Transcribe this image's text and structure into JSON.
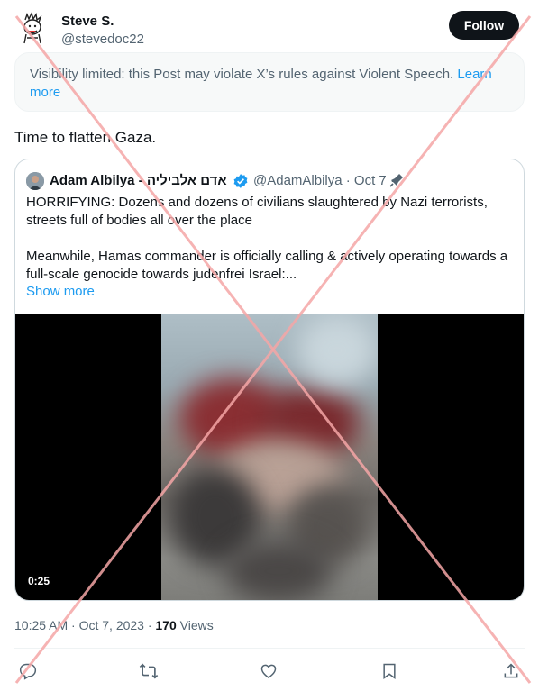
{
  "author": {
    "name": "Steve S.",
    "handle": "@stevedoc22",
    "follow_label": "Follow"
  },
  "notice": {
    "text": "Visibility limited: this Post may violate X’s rules against Violent Speech. ",
    "link": "Learn more"
  },
  "tweet": {
    "text": "Time to flatten Gaza."
  },
  "quoted": {
    "name": "Adam Albilya - אדם אלביליה",
    "handle": "@AdamAlbilya · Oct 7 ·",
    "paragraph1": "HORRIFYING: Dozens and dozens of civilians slaughtered by Nazi terrorists, streets full of bodies all over the place",
    "paragraph2": "Meanwhile, Hamas commander is officially calling & actively operating towards a full-scale genocide towards judenfrei Israel:...",
    "show_more": "Show more",
    "video_duration": "0:25"
  },
  "meta": {
    "time": "10:25 AM · Oct 7, 2023 · ",
    "views_count": "170",
    "views_label": " Views"
  },
  "icons": [
    "reply-icon",
    "repost-icon",
    "like-icon",
    "bookmark-icon",
    "share-icon",
    "verified-badge-icon",
    "pin-icon"
  ],
  "colors": {
    "link": "#1d9bf0",
    "text": "#0f1419",
    "secondary": "#536471",
    "cross": "#f4a6a6"
  }
}
